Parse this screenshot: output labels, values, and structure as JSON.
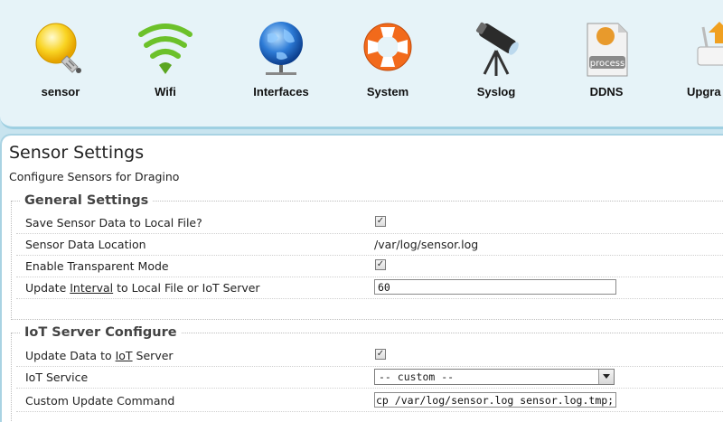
{
  "nav": {
    "items": [
      {
        "label": "sensor"
      },
      {
        "label": "Wifi"
      },
      {
        "label": "Interfaces"
      },
      {
        "label": "System"
      },
      {
        "label": "Syslog"
      },
      {
        "label": "DDNS"
      },
      {
        "label": "Upgra"
      }
    ],
    "ddns_icon_text": "process"
  },
  "page": {
    "title": "Sensor Settings",
    "description": "Configure Sensors for Dragino"
  },
  "general": {
    "legend": "General Settings",
    "save_local": {
      "label": "Save Sensor Data to Local File?",
      "checked": true
    },
    "location": {
      "label": "Sensor Data Location",
      "value": "/var/log/sensor.log"
    },
    "transparent": {
      "label": "Enable Transparent Mode",
      "checked": true
    },
    "interval": {
      "label_pre": "Update ",
      "label_u": "Interval",
      "label_post": " to Local File or IoT Server",
      "value": "60"
    }
  },
  "iot": {
    "legend": "IoT Server Configure",
    "update": {
      "label_pre": "Update Data to ",
      "label_u": "IoT",
      "label_post": " Server",
      "checked": true
    },
    "service": {
      "label": "IoT Service",
      "value": "-- custom --"
    },
    "command": {
      "label": "Custom Update Command",
      "value": "cp /var/log/sensor.log sensor.log.tmp;"
    }
  }
}
